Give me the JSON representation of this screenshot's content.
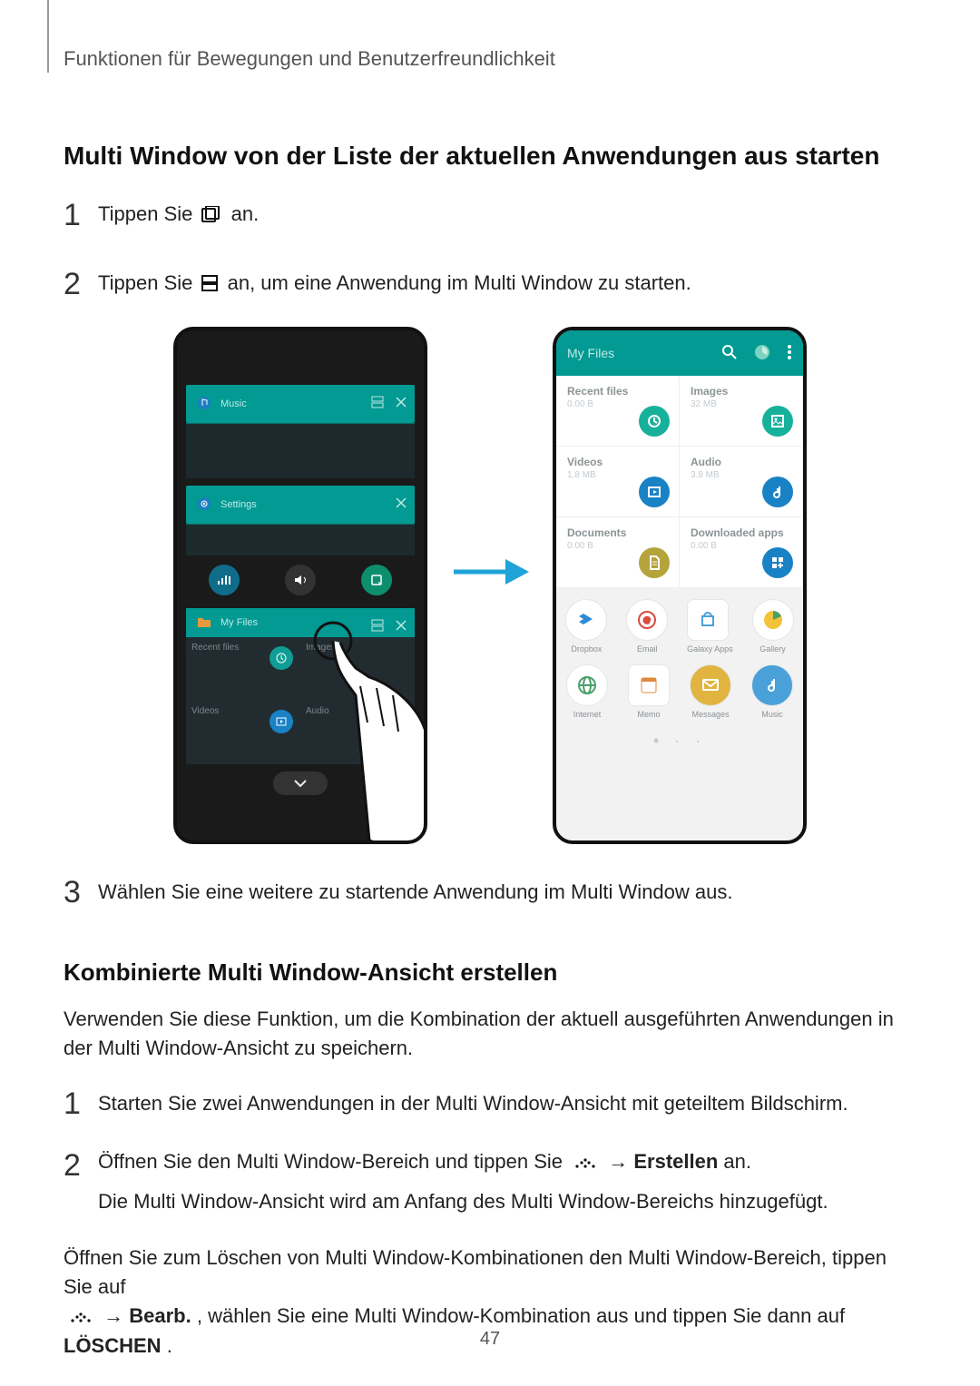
{
  "header": {
    "chapter": "Funktionen für Bewegungen und Benutzerfreundlichkeit"
  },
  "section1": {
    "title": "Multi Window von der Liste der aktuellen Anwendungen aus starten",
    "step1": {
      "num": "1",
      "pre": "Tippen Sie ",
      "post": " an."
    },
    "step2": {
      "num": "2",
      "pre": "Tippen Sie ",
      "post": " an, um eine Anwendung im Multi Window zu starten."
    },
    "step3": {
      "num": "3",
      "text": "Wählen Sie eine weitere zu startende Anwendung im Multi Window aus."
    }
  },
  "left_phone": {
    "music": "Music",
    "settings": "Settings",
    "myfiles": "My Files",
    "cells": [
      "Recent files",
      "Images",
      "Videos",
      "Audio"
    ]
  },
  "right_phone": {
    "title": "My Files",
    "cells": [
      {
        "t": "Recent files",
        "s": "0.00 B",
        "color": "#17b19b",
        "icon": "recent"
      },
      {
        "t": "Images",
        "s": "32 MB",
        "color": "#17b19b",
        "icon": "image"
      },
      {
        "t": "Videos",
        "s": "1.8 MB",
        "color": "#1982c4",
        "icon": "video"
      },
      {
        "t": "Audio",
        "s": "3.8 MB",
        "color": "#1982c4",
        "icon": "audio"
      },
      {
        "t": "Documents",
        "s": "0.00 B",
        "color": "#b5a33c",
        "icon": "doc"
      },
      {
        "t": "Downloaded apps",
        "s": "0.00 B",
        "color": "#1982c4",
        "icon": "apps"
      }
    ],
    "apps": [
      {
        "l": "Dropbox"
      },
      {
        "l": "Email"
      },
      {
        "l": "Galaxy Apps"
      },
      {
        "l": "Gallery"
      },
      {
        "l": "Internet"
      },
      {
        "l": "Memo"
      },
      {
        "l": "Messages"
      },
      {
        "l": "Music"
      }
    ]
  },
  "section2": {
    "title": "Kombinierte Multi Window-Ansicht erstellen",
    "intro": "Verwenden Sie diese Funktion, um die Kombination der aktuell ausgeführten Anwendungen in der Multi Window-Ansicht zu speichern.",
    "step1": {
      "num": "1",
      "text": "Starten Sie zwei Anwendungen in der Multi Window-Ansicht mit geteiltem Bildschirm."
    },
    "step2": {
      "num": "2",
      "pre": "Öffnen Sie den Multi Window-Bereich und tippen Sie ",
      "arrow": " → ",
      "bold": "Erstellen",
      "post": " an.",
      "sub": "Die Multi Window-Ansicht wird am Anfang des Multi Window-Bereichs hinzugefügt."
    },
    "outro_pre": "Öffnen Sie zum Löschen von Multi Window-Kombinationen den Multi Window-Bereich, tippen Sie auf ",
    "outro_arrow": " → ",
    "outro_bold1": "Bearb.",
    "outro_mid": ", wählen Sie eine Multi Window-Kombination aus und tippen Sie dann auf ",
    "outro_bold2": "LÖSCHEN",
    "outro_end": "."
  },
  "page_number": "47"
}
